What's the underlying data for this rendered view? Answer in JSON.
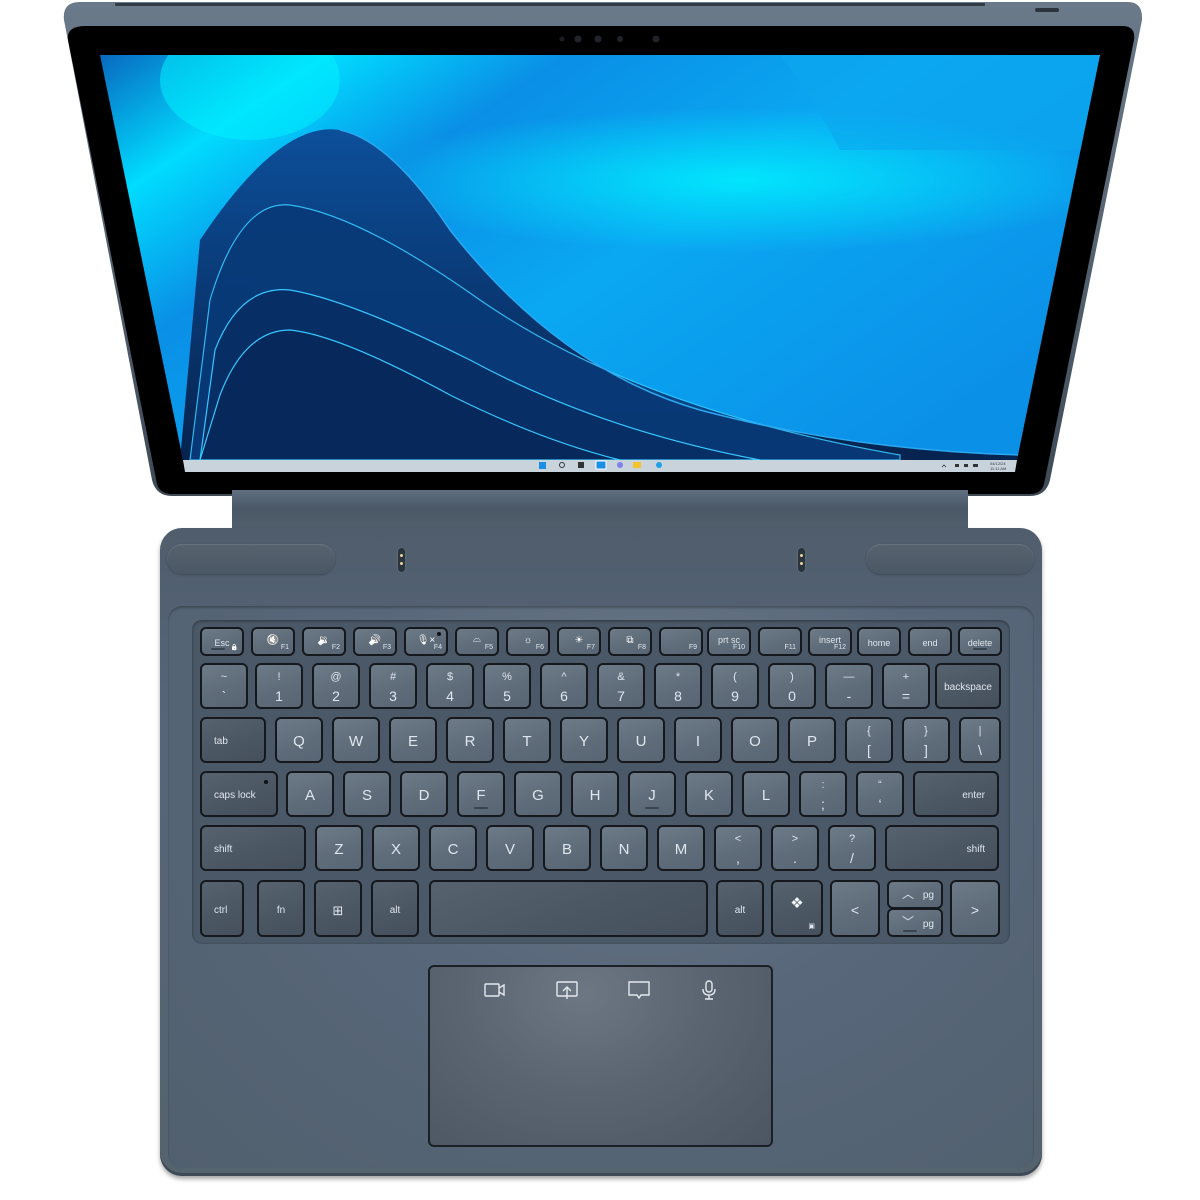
{
  "device": {
    "type": "2-in-1 detachable tablet with keyboard cover",
    "colors": {
      "body": "#4f5d6c",
      "bezel": "#000000",
      "key": "#5f6c7a",
      "legend": "#dfe6ee",
      "wallpaper_light": "#00e5ff",
      "wallpaper_mid": "#0a8fe6",
      "wallpaper_dark": "#0b2a5c"
    }
  },
  "screen": {
    "wallpaper": "Windows 11 blue ribbon waves",
    "taskbar": {
      "icons": [
        {
          "name": "start-icon",
          "glyph": "windows-logo",
          "color": "#1a8fe6"
        },
        {
          "name": "search-icon",
          "glyph": "magnifier",
          "color": "#333333"
        },
        {
          "name": "task-view-icon",
          "glyph": "stacked-windows",
          "color": "#333333"
        },
        {
          "name": "widgets-icon",
          "glyph": "widgets",
          "color": "#1a8fe6"
        },
        {
          "name": "chat-icon",
          "glyph": "teams-chat",
          "color": "#7b83eb"
        },
        {
          "name": "file-explorer-icon",
          "glyph": "folder",
          "color": "#f4c430"
        },
        {
          "name": "edge-icon",
          "glyph": "edge",
          "color": "#1fa1e6"
        }
      ],
      "tray": {
        "date": "04/12/24",
        "time": "11:11 AM"
      }
    }
  },
  "keyboard": {
    "rows": [
      [
        {
          "main": "Esc",
          "sub": "🔒",
          "type": "fn"
        },
        {
          "main": "🔇",
          "fn": "F1",
          "type": "fn"
        },
        {
          "main": "🔉",
          "fn": "F2",
          "type": "fn"
        },
        {
          "main": "🔊",
          "fn": "F3",
          "type": "fn"
        },
        {
          "main": "🎙×",
          "fn": "F4",
          "type": "fn",
          "indicator": true
        },
        {
          "main": "kbd-light",
          "fn": "F5",
          "type": "fn"
        },
        {
          "main": "☼",
          "fn": "F6",
          "type": "fn"
        },
        {
          "main": "☀",
          "fn": "F7",
          "type": "fn"
        },
        {
          "main": "⧉",
          "fn": "F8",
          "type": "fn"
        },
        {
          "main": "",
          "fn": "F9",
          "type": "fn"
        },
        {
          "main": "prt sc",
          "fn": "F10",
          "type": "fn"
        },
        {
          "main": "",
          "fn": "F11",
          "type": "fn"
        },
        {
          "main": "insert",
          "fn": "F12",
          "type": "fn"
        },
        {
          "main": "home",
          "type": "fn"
        },
        {
          "main": "end",
          "type": "fn"
        },
        {
          "main": "delete",
          "type": "fn"
        }
      ],
      [
        {
          "top": "~",
          "bottom": "`"
        },
        {
          "top": "!",
          "bottom": "1"
        },
        {
          "top": "@",
          "bottom": "2"
        },
        {
          "top": "#",
          "bottom": "3"
        },
        {
          "top": "$",
          "bottom": "4"
        },
        {
          "top": "%",
          "bottom": "5"
        },
        {
          "top": "^",
          "bottom": "6"
        },
        {
          "top": "&",
          "bottom": "7"
        },
        {
          "top": "*",
          "bottom": "8"
        },
        {
          "top": "(",
          "bottom": "9"
        },
        {
          "top": ")",
          "bottom": "0"
        },
        {
          "top": "—",
          "bottom": "-"
        },
        {
          "top": "+",
          "bottom": "="
        },
        {
          "label": "backspace"
        }
      ],
      [
        {
          "label": "tab"
        },
        {
          "letter": "Q"
        },
        {
          "letter": "W"
        },
        {
          "letter": "E"
        },
        {
          "letter": "R"
        },
        {
          "letter": "T"
        },
        {
          "letter": "Y"
        },
        {
          "letter": "U"
        },
        {
          "letter": "I"
        },
        {
          "letter": "O"
        },
        {
          "letter": "P"
        },
        {
          "top": "{",
          "bottom": "["
        },
        {
          "top": "}",
          "bottom": "]"
        },
        {
          "top": "|",
          "bottom": "\\"
        }
      ],
      [
        {
          "label": "caps lock"
        },
        {
          "letter": "A"
        },
        {
          "letter": "S"
        },
        {
          "letter": "D"
        },
        {
          "letter": "F"
        },
        {
          "letter": "G"
        },
        {
          "letter": "H"
        },
        {
          "letter": "J"
        },
        {
          "letter": "K"
        },
        {
          "letter": "L"
        },
        {
          "top": ":",
          "bottom": ";"
        },
        {
          "top": "“",
          "bottom": "‘"
        },
        {
          "label": "enter"
        }
      ],
      [
        {
          "label": "shift"
        },
        {
          "letter": "Z"
        },
        {
          "letter": "X"
        },
        {
          "letter": "C"
        },
        {
          "letter": "V"
        },
        {
          "letter": "B"
        },
        {
          "letter": "N"
        },
        {
          "letter": "M"
        },
        {
          "top": "<",
          "bottom": ","
        },
        {
          "top": ">",
          "bottom": "."
        },
        {
          "top": "?",
          "bottom": "/"
        },
        {
          "label": "shift"
        }
      ],
      [
        {
          "label": "ctrl"
        },
        {
          "label": "fn"
        },
        {
          "label": "windows"
        },
        {
          "label": "alt"
        },
        {
          "label": "space"
        },
        {
          "label": "alt"
        },
        {
          "label": "copilot"
        },
        {
          "label": "<"
        },
        {
          "up": "^",
          "down": "v",
          "pg": "pg"
        },
        {
          "label": ">"
        }
      ]
    ]
  },
  "trackpad": {
    "icons": [
      {
        "name": "video-camera-icon",
        "meaning": "camera"
      },
      {
        "name": "share-screen-icon",
        "meaning": "share screen"
      },
      {
        "name": "chat-icon",
        "meaning": "chat"
      },
      {
        "name": "microphone-icon",
        "meaning": "microphone"
      }
    ]
  }
}
